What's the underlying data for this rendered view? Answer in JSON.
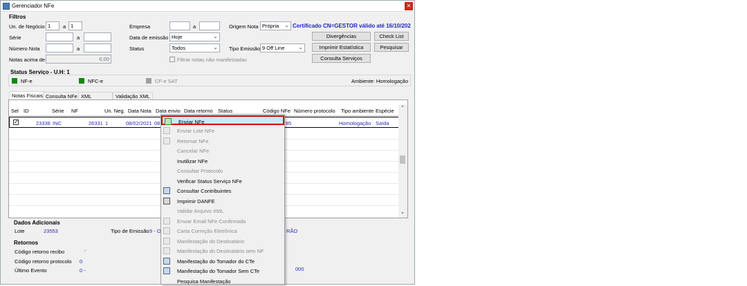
{
  "window": {
    "title": "Gerenciador NFe",
    "close": "✕"
  },
  "filtros": {
    "title": "Filtros",
    "un_negocio_label": "Un. de Negócio",
    "un_negocio_from": "1",
    "un_negocio_a": "a",
    "un_negocio_to": "1",
    "serie_label": "Série",
    "serie_a": "a",
    "numero_nota_label": "Número Nota",
    "numero_nota_a": "a",
    "notas_acima_label": "Notas acima de",
    "notas_acima_value": "0,00",
    "empresa_label": "Empresa",
    "empresa_a": "a",
    "data_emissao_label": "Data de emissão",
    "data_emissao_value": "Hoje",
    "status_label": "Status",
    "status_value": "Todos",
    "filtrar_label": "Filtrar notas não manifestadas",
    "origem_label": "Origem Nota",
    "origem_value": "Própria",
    "tipo_emissao_label": "Tipo Emissão",
    "tipo_emissao_value": "9 Off Line",
    "certificado": "Certificado CN=GESTOR válido até 16/10/202",
    "btn_divergencias": "Divergências",
    "btn_checklist": "Check List",
    "btn_imprimir": "Imprimir Estatística",
    "btn_pesquisar": "Pesquisar",
    "btn_consulta": "Consulta Serviços"
  },
  "status_servico": {
    "title": "Status Serviço - U.H: 1",
    "nfe": "NF-e",
    "nfce": "NFC-e",
    "cfe": "CF-e SAT",
    "ambiente": "Ambiente: Homologação",
    "colors": {
      "nfe": "#0a8a0a",
      "nfce": "#0a8a0a",
      "cfe": "#a0a0a0"
    }
  },
  "tabs": [
    "Notas Fiscais",
    "Consulta NFe",
    "XML",
    "Validação XML"
  ],
  "grid": {
    "headers": [
      "Sel",
      "ID",
      "Série",
      "NF",
      "Un. Neg.",
      "Data Nota",
      "Data envio",
      "Data retorno",
      "Status",
      "Código NFe",
      "Número protocolo",
      "Tipo ambiente",
      "Espécie"
    ],
    "row": {
      "id": "23338",
      "serie": "INC",
      "nf": "26331",
      "un": "1",
      "data": "08/02/2021",
      "envio": "08",
      "codigo": "85",
      "tipo": "Homologação",
      "especie": "Saída"
    }
  },
  "menu": [
    {
      "label": "Enviar NFe",
      "enabled": true,
      "icon": "send-icon"
    },
    {
      "label": "Enviar Lote NFe",
      "enabled": false,
      "icon": "send-batch-icon"
    },
    {
      "label": "Retornar NFe",
      "enabled": false,
      "icon": "return-icon"
    },
    {
      "label": "Cancelar NFe",
      "enabled": false,
      "icon": ""
    },
    {
      "label": "Inutilizar NFe",
      "enabled": true,
      "icon": ""
    },
    {
      "label": "Consultar Protocolo",
      "enabled": false,
      "icon": ""
    },
    {
      "label": "Verificar Status Serviço NFe",
      "enabled": true,
      "icon": ""
    },
    {
      "label": "Consultar Contribuintes",
      "enabled": true,
      "icon": "contacts-icon"
    },
    {
      "label": "Imprimir DANFE",
      "enabled": true,
      "icon": "printer-icon"
    },
    {
      "label": "Validar Arquivo XML",
      "enabled": false,
      "icon": ""
    },
    {
      "label": "Enviar Email NFe Confirmada",
      "enabled": false,
      "icon": "email-icon"
    },
    {
      "label": "Carta Correção Eletrônica",
      "enabled": false,
      "icon": "document-icon"
    },
    {
      "label": "Manifestação do Destinatário",
      "enabled": false,
      "icon": "document-icon"
    },
    {
      "label": "Manifestação do Destinatário sem NF",
      "enabled": false,
      "icon": "document-icon"
    },
    {
      "label": "Manifestação do Tomador do CTe",
      "enabled": true,
      "icon": "stack-icon"
    },
    {
      "label": "Manifestação do Tomador Sem CTe",
      "enabled": true,
      "icon": "stack-icon"
    },
    {
      "label": "Pesquisa Manifestação",
      "enabled": true,
      "icon": ""
    }
  ],
  "dados_adicionais": {
    "title": "Dados Adicionais",
    "lote_label": "Lote",
    "lote_value": "23553",
    "tipo_emissao_label": "Tipo de Emissão",
    "tipo_emissao_value": "9 - O",
    "right_value": "RÃO"
  },
  "retornos": {
    "title": "Retornos",
    "recibo_label": "Código retorno recibo",
    "recibo_value": "-",
    "protocolo_label": "Código retorno protocolo",
    "protocolo_value": "0",
    "evento_label": "Último Evento",
    "evento_value": "0 -",
    "right_value": "000"
  }
}
